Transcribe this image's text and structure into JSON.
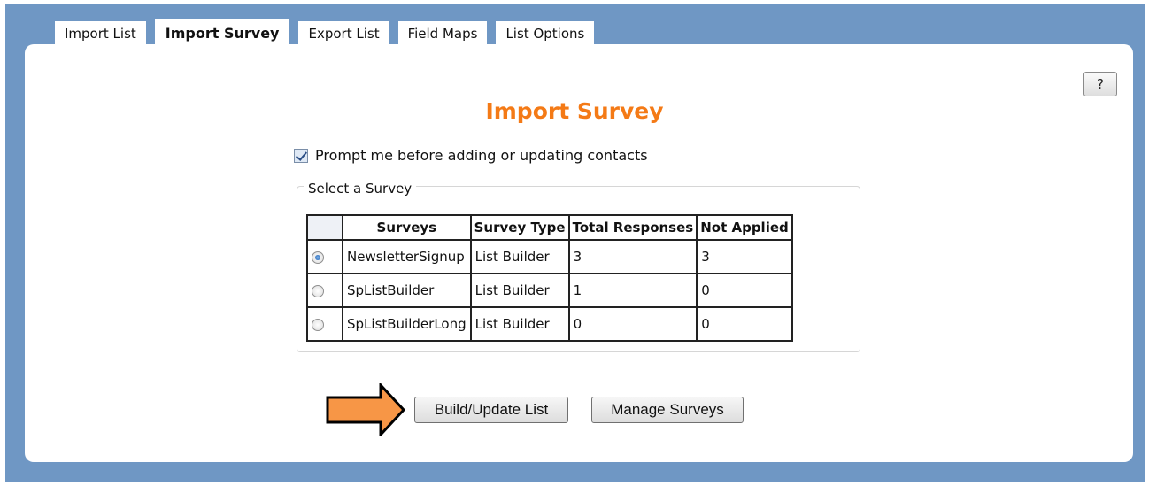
{
  "tabs": [
    {
      "label": "Import List",
      "active": false
    },
    {
      "label": "Import Survey",
      "active": true
    },
    {
      "label": "Export List",
      "active": false
    },
    {
      "label": "Field Maps",
      "active": false
    },
    {
      "label": "List Options",
      "active": false
    }
  ],
  "help_label": "?",
  "page_title": "Import Survey",
  "prompt": {
    "checked": true,
    "label": "Prompt me before adding or updating contacts"
  },
  "survey_group": {
    "legend": "Select a Survey",
    "columns": [
      "Surveys",
      "Survey Type",
      "Total Responses",
      "Not Applied"
    ],
    "rows": [
      {
        "selected": true,
        "survey": "NewsletterSignup",
        "type": "List Builder",
        "total": "3",
        "not_applied": "3"
      },
      {
        "selected": false,
        "survey": "SpListBuilder",
        "type": "List Builder",
        "total": "1",
        "not_applied": "0"
      },
      {
        "selected": false,
        "survey": "SpListBuilderLong",
        "type": "List Builder",
        "total": "0",
        "not_applied": "0"
      }
    ]
  },
  "buttons": {
    "build": "Build/Update List",
    "manage": "Manage Surveys"
  },
  "colors": {
    "frame": "#6f97c4",
    "title": "#f47a16",
    "arrow": "#f79646"
  },
  "icons": {
    "pointer": "arrow-right-icon"
  }
}
